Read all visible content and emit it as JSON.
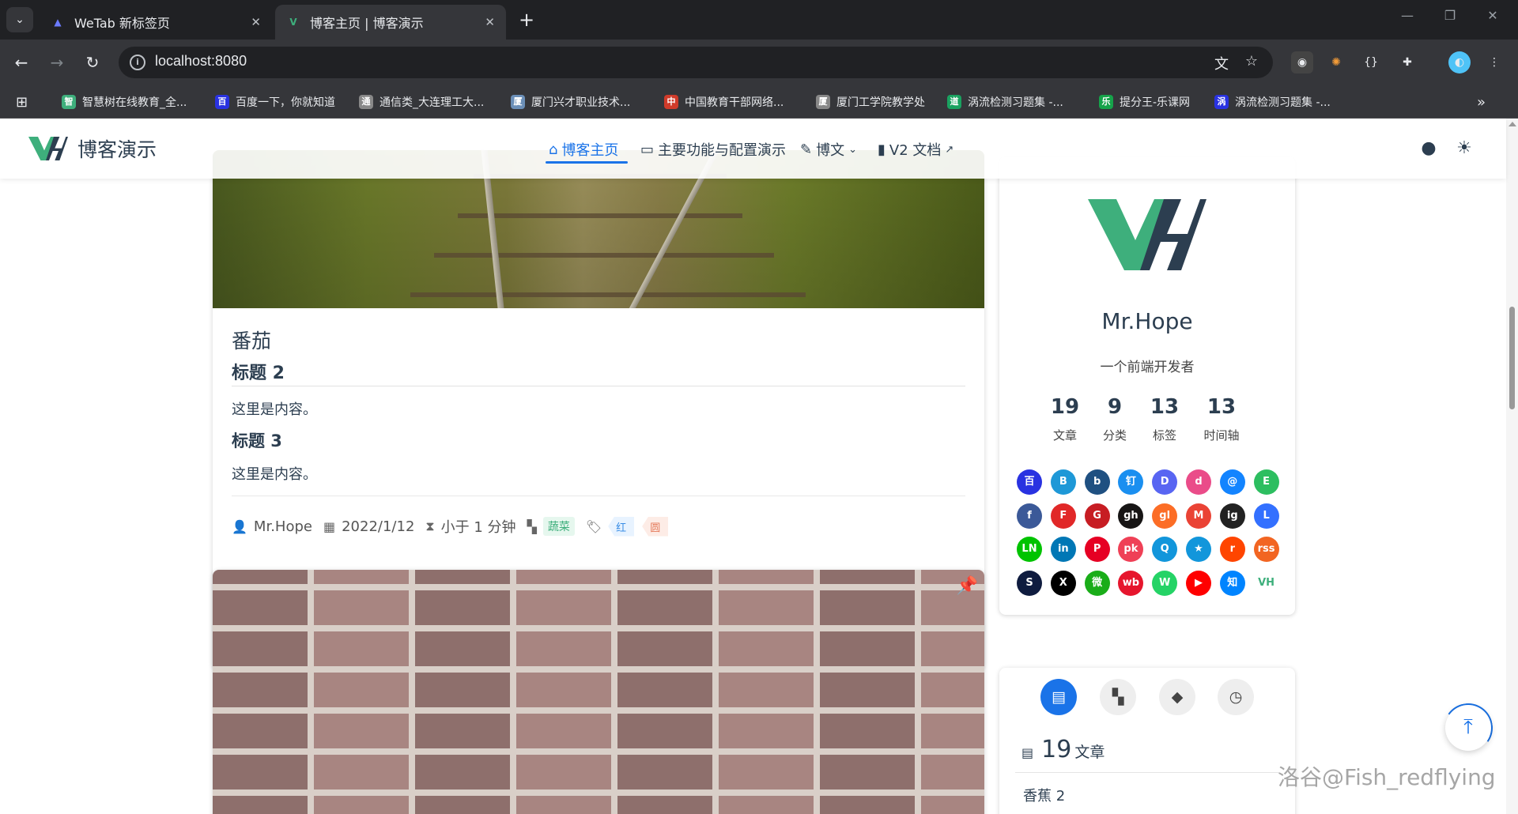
{
  "browser": {
    "tabs": [
      {
        "title": "WeTab 新标签页",
        "active": false,
        "icon": "wetab-icon"
      },
      {
        "title": "博客主页 | 博客演示",
        "active": true,
        "icon": "vuepress-hope-icon"
      }
    ],
    "url": "localhost:8080",
    "bookmarks": [
      {
        "label": "智慧树在线教育_全...",
        "color": "#3eaf7c"
      },
      {
        "label": "百度一下，你就知道",
        "color": "#2932e1"
      },
      {
        "label": "通信类_大连理工大...",
        "color": "#888888"
      },
      {
        "label": "厦门兴才职业技术...",
        "color": "#6b8fb8"
      },
      {
        "label": "中国教育干部网络...",
        "color": "#d03b2a"
      },
      {
        "label": "厦门工学院教学处",
        "color": "#888888"
      },
      {
        "label": "涡流检测习题集 -...",
        "color": "#1aa260"
      },
      {
        "label": "提分王-乐课网",
        "color": "#16a34a"
      },
      {
        "label": "涡流检测习题集 -...",
        "color": "#2932e1"
      }
    ],
    "bookmark_glyphs": [
      "智",
      "百",
      "通",
      "厦",
      "中",
      "厦",
      "道",
      "乐",
      "涡"
    ]
  },
  "site": {
    "title": "博客演示",
    "nav": [
      {
        "label": "博客主页",
        "icon": "home-icon",
        "active": true
      },
      {
        "label": "主要功能与配置演示",
        "icon": "laptop-code-icon",
        "active": false
      },
      {
        "label": "博文",
        "icon": "pen-to-square-icon",
        "active": false,
        "dropdown": true
      },
      {
        "label": "V2 文档",
        "icon": "book-icon",
        "active": false,
        "external": true
      }
    ]
  },
  "article": {
    "title": "番茄",
    "h2": "标题 2",
    "p1": "这里是内容。",
    "h3": "标题 3",
    "p2": "这里是内容。",
    "author": "Mr.Hope",
    "date": "2022/1/12",
    "reading_time": "小于 1 分钟",
    "category": "蔬菜",
    "tags": [
      "红",
      "圆"
    ]
  },
  "profile": {
    "name": "Mr.Hope",
    "description": "一个前端开发者",
    "stats": [
      {
        "value": "19",
        "label": "文章"
      },
      {
        "value": "9",
        "label": "分类"
      },
      {
        "value": "13",
        "label": "标签"
      },
      {
        "value": "13",
        "label": "时间轴"
      }
    ],
    "social_icons": [
      {
        "name": "baidu-icon",
        "glyph": "百",
        "color": "#2932e1"
      },
      {
        "name": "bilibili-icon",
        "glyph": "B",
        "color": "#1e98d7"
      },
      {
        "name": "bitbucket-icon",
        "glyph": "b",
        "color": "#1f5081"
      },
      {
        "name": "dingding-icon",
        "glyph": "钉",
        "color": "#1a8ff0"
      },
      {
        "name": "discord-icon",
        "glyph": "D",
        "color": "#5865f2"
      },
      {
        "name": "dribbble-icon",
        "glyph": "d",
        "color": "#ea4c89"
      },
      {
        "name": "email-icon",
        "glyph": "@",
        "color": "#1384ff"
      },
      {
        "name": "evernote-icon",
        "glyph": "E",
        "color": "#2dbe60"
      },
      {
        "name": "facebook-icon",
        "glyph": "f",
        "color": "#3b5998"
      },
      {
        "name": "flipboard-icon",
        "glyph": "F",
        "color": "#e12828"
      },
      {
        "name": "gitee-icon",
        "glyph": "G",
        "color": "#c71d23"
      },
      {
        "name": "github-icon",
        "glyph": "gh",
        "color": "#171515"
      },
      {
        "name": "gitlab-icon",
        "glyph": "gl",
        "color": "#fc6d26"
      },
      {
        "name": "gmail-icon",
        "glyph": "M",
        "color": "#ea4335"
      },
      {
        "name": "instagram-icon",
        "glyph": "ig",
        "color": "#222222"
      },
      {
        "name": "lark-icon",
        "glyph": "L",
        "color": "#3370ff"
      },
      {
        "name": "line-icon",
        "glyph": "LN",
        "color": "#00c300"
      },
      {
        "name": "linkedin-icon",
        "glyph": "in",
        "color": "#0077b5"
      },
      {
        "name": "pinterest-icon",
        "glyph": "P",
        "color": "#e60023"
      },
      {
        "name": "pocket-icon",
        "glyph": "pk",
        "color": "#ef4056"
      },
      {
        "name": "qq-icon",
        "glyph": "Q",
        "color": "#1296db"
      },
      {
        "name": "qzone-icon",
        "glyph": "★",
        "color": "#1296db"
      },
      {
        "name": "reddit-icon",
        "glyph": "r",
        "color": "#ff4500"
      },
      {
        "name": "rss-icon",
        "glyph": "rss",
        "color": "#f26522"
      },
      {
        "name": "steam-icon",
        "glyph": "S",
        "color": "#0f1c3f"
      },
      {
        "name": "twitter-x-icon",
        "glyph": "X",
        "color": "#000000"
      },
      {
        "name": "wechat-icon",
        "glyph": "微",
        "color": "#1aad19"
      },
      {
        "name": "weibo-icon",
        "glyph": "wb",
        "color": "#e6162d"
      },
      {
        "name": "whatsapp-icon",
        "glyph": "W",
        "color": "#25d366"
      },
      {
        "name": "youtube-icon",
        "glyph": "▶",
        "color": "#ff0000"
      },
      {
        "name": "zhihu-icon",
        "glyph": "知",
        "color": "#0084ff"
      },
      {
        "name": "vuepress-hope-icon",
        "glyph": "VH",
        "color": "#ffffff"
      }
    ]
  },
  "info": {
    "article_count": "19",
    "article_label": "文章",
    "first_item": "香蕉 2"
  },
  "watermark": "洛谷@Fish_redflying",
  "colors": {
    "accent": "#1a73e8",
    "brand_green": "#3eaf7c",
    "brand_navy": "#2c3e50"
  }
}
